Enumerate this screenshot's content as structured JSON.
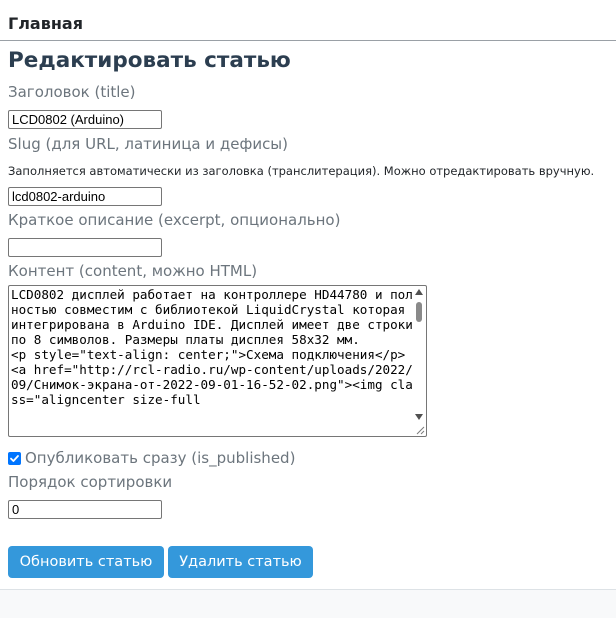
{
  "nav": {
    "title": "Главная"
  },
  "page": {
    "title": "Редактировать статью"
  },
  "form": {
    "title_label": "Заголовок (title)",
    "title_value": "LCD0802 (Arduino)",
    "slug_label": "Slug (для URL, латиница и дефисы)",
    "slug_help": "Заполняется автоматически из заголовка (транслитерация). Можно отредактировать вручную.",
    "slug_value": "lcd0802-arduino",
    "excerpt_label": "Краткое описание (excerpt, опционально)",
    "excerpt_value": "",
    "content_label": "Контент (content, можно HTML)",
    "content_value": "LCD0802 дисплей работает на контроллере HD44780 и полностью совместим с библиотекой LiquidCrystal которая интегрирована в Arduino IDE. Дисплей имеет две строки по 8 символов. Размеры платы дисплея 58x32 мм.\n<p style=\"text-align: center;\">Схема подключения</p>\n<a href=\"http://rcl-radio.ru/wp-content/uploads/2022/09/Снимок-экрана-от-2022-09-01-16-52-02.png\"><img class=\"aligncenter size-full",
    "publish_label": "Опубликовать сразу (is_published)",
    "publish_checked": true,
    "sort_label": "Порядок сортировки",
    "sort_value": "0"
  },
  "actions": {
    "update_label": "Обновить статью",
    "delete_label": "Удалить статью"
  },
  "colors": {
    "accent": "#3498db",
    "heading": "#2c3e50",
    "label": "#6c757d",
    "checkbox": "#0075ff"
  }
}
